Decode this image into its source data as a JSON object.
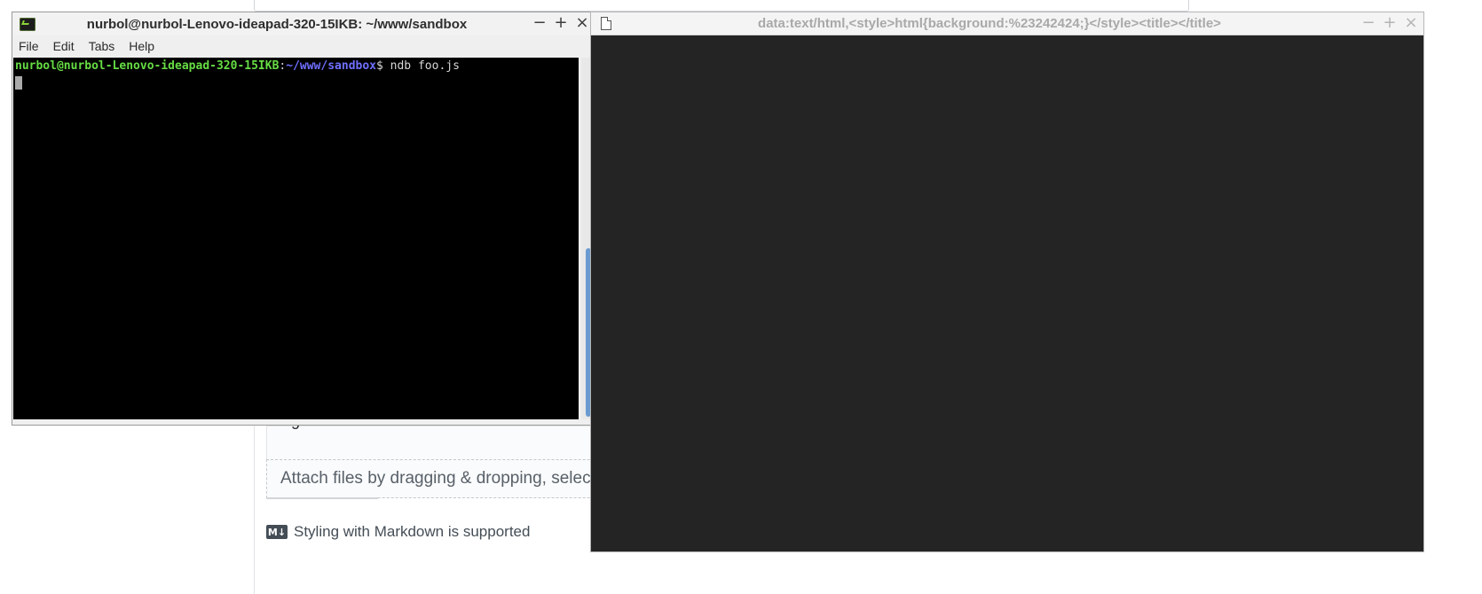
{
  "background_page": {
    "partial_text": "g",
    "attach_text": "Attach files by dragging & dropping, selec",
    "markdown_badge": "M↓",
    "markdown_note": "Styling with Markdown is supported"
  },
  "terminal": {
    "title": "nurbol@nurbol-Lenovo-ideapad-320-15IKB: ~/www/sandbox",
    "controls": {
      "minimize": "−",
      "maximize": "+",
      "close": "×"
    },
    "menu": [
      "File",
      "Edit",
      "Tabs",
      "Help"
    ],
    "prompt_user": "nurbol@nurbol-Lenovo-ideapad-320-15IKB",
    "prompt_sep": ":",
    "prompt_path": "~/www/sandbox",
    "prompt_symbol": "$ ",
    "command": "ndb foo.js",
    "colors": {
      "user": "#66dd44",
      "path": "#6f6fff",
      "background": "#000000"
    }
  },
  "browser": {
    "title": "data:text/html,<style>html{background:%23242424;}</style><title></title>",
    "controls": {
      "minimize": "−",
      "maximize": "+",
      "close": "×"
    },
    "background_color": "#242424"
  }
}
